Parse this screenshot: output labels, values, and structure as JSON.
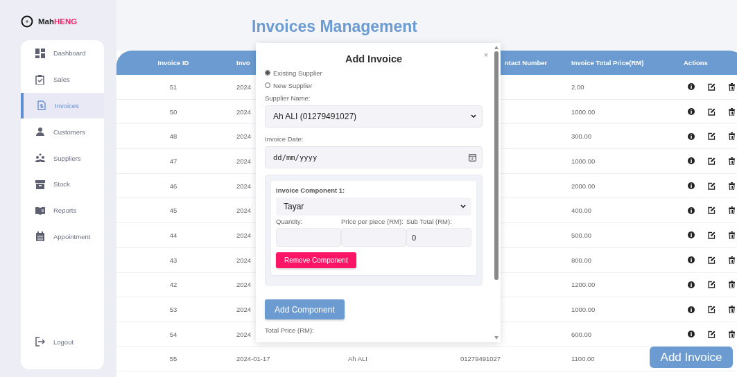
{
  "brand": {
    "plain": "Mah",
    "accent": "HENG"
  },
  "page_title": "Invoices Management",
  "sidebar": {
    "items": [
      {
        "label": "Dashboard",
        "selected": false
      },
      {
        "label": "Sales",
        "selected": false
      },
      {
        "label": "Invoices",
        "selected": true
      },
      {
        "label": "Customers",
        "selected": false
      },
      {
        "label": "Suppliers",
        "selected": false
      },
      {
        "label": "Stock",
        "selected": false
      },
      {
        "label": "Reports",
        "selected": false
      },
      {
        "label": "Appointment",
        "selected": false
      }
    ],
    "logout": "Logout"
  },
  "table": {
    "columns": {
      "invoice_id": "Invoice ID",
      "column_2": "Invo",
      "column_4": "ntact Number",
      "total_price": "Invoice Total Price(RM)",
      "actions": "Actions"
    },
    "rows": [
      {
        "id": "51",
        "date": "2024",
        "price": "2.00",
        "actions": true
      },
      {
        "id": "50",
        "date": "2024",
        "price": "1000.00",
        "actions": true
      },
      {
        "id": "48",
        "date": "2024",
        "price": "300.00",
        "actions": true
      },
      {
        "id": "47",
        "date": "2024",
        "price": "1000.00",
        "actions": true
      },
      {
        "id": "46",
        "date": "2024",
        "price": "2000.00",
        "actions": true
      },
      {
        "id": "45",
        "date": "2024",
        "price": "400.00",
        "actions": true
      },
      {
        "id": "44",
        "date": "2024",
        "price": "500.00",
        "actions": true
      },
      {
        "id": "43",
        "date": "2024",
        "price": "800.00",
        "actions": true
      },
      {
        "id": "42",
        "date": "2024",
        "price": "1200.00",
        "actions": true
      },
      {
        "id": "53",
        "date": "2024",
        "price": "1000.00",
        "actions": true
      },
      {
        "id": "54",
        "date": "2024",
        "price": "600.00",
        "actions": true
      },
      {
        "id": "55",
        "date": "2024-01-17",
        "supplier": "Ah ALI",
        "contact": "01279491027",
        "price": "1100.00",
        "actions": false
      }
    ]
  },
  "modal": {
    "title": "Add Invoice",
    "close": "×",
    "supplier_type": [
      {
        "label": "Existing Supplier",
        "selected": true
      },
      {
        "label": "New Supplier",
        "selected": false
      }
    ],
    "supplier_label": "Supplier Name:",
    "supplier_value": "Ah ALI (01279491027)",
    "date_label": "Invoice Date:",
    "date_placeholder": "dd/mm/yyyy",
    "components": [
      {
        "title": "Invoice Component 1:",
        "item": "Tayar",
        "quantity_label": "Quantity:",
        "price_label": "Price per piece (RM):",
        "subtotal_label": "Sub Total (RM):",
        "subtotal_value": "0",
        "remove": "Remove Component"
      }
    ],
    "add_component": "Add Component",
    "total_label": "Total Price (RM):"
  },
  "add_invoice": "Add Invoice"
}
